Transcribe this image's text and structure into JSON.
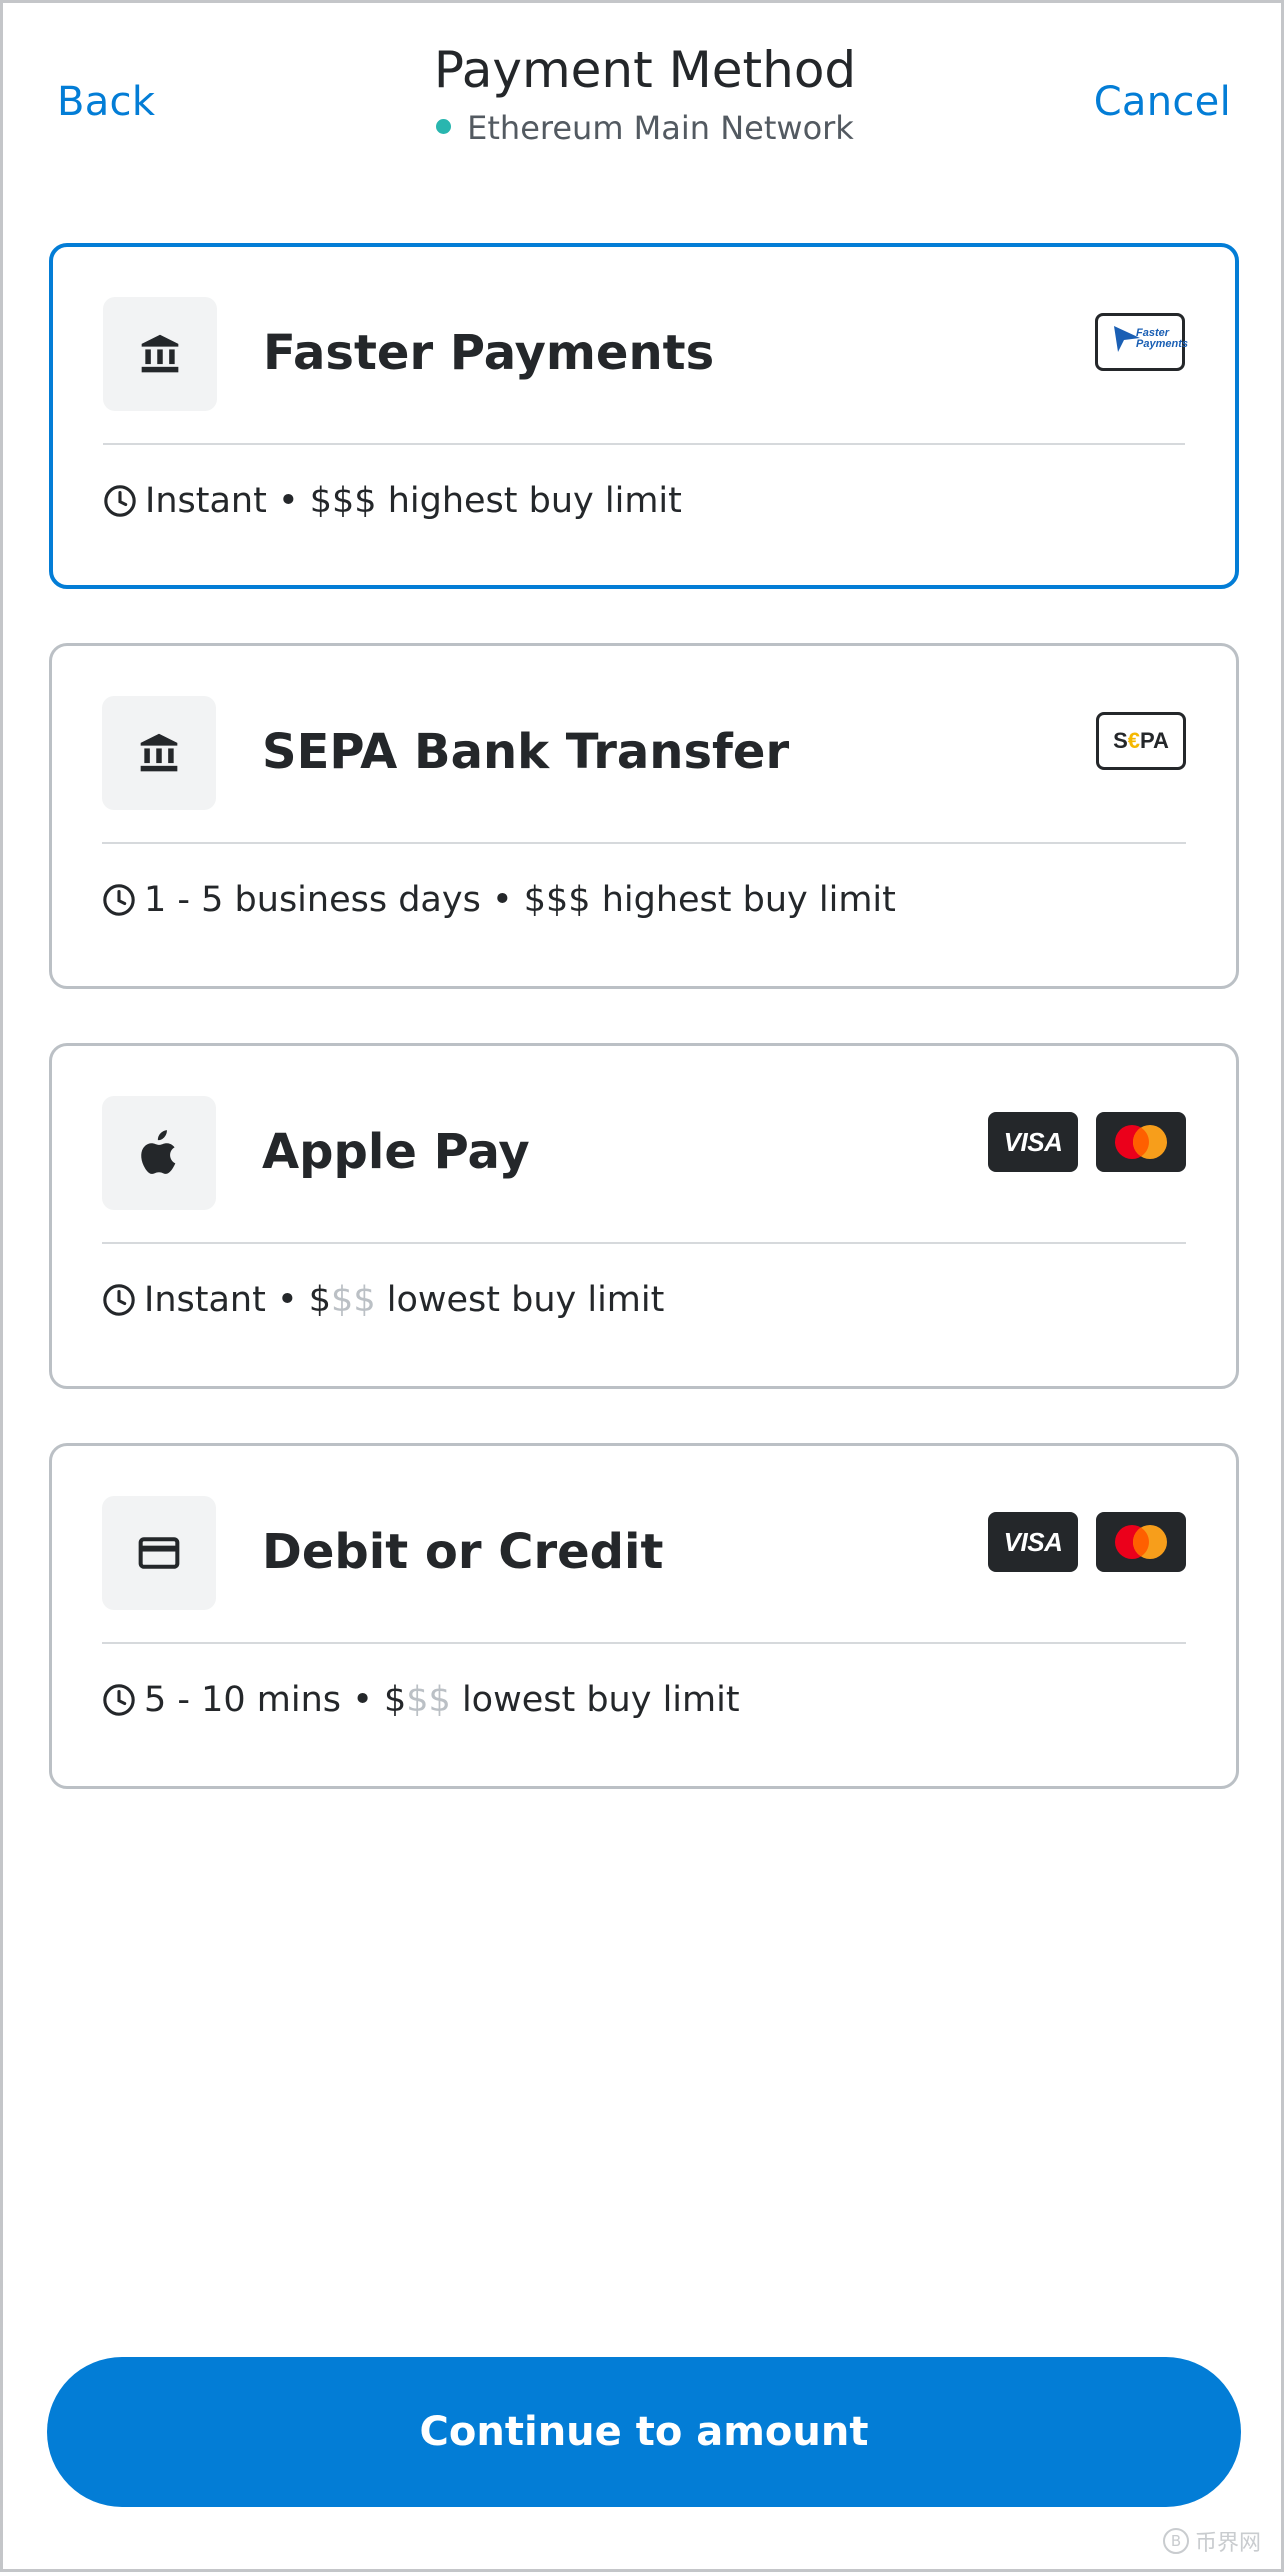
{
  "header": {
    "back_label": "Back",
    "title": "Payment Method",
    "network_label": "Ethereum Main Network",
    "network_status_color": "#29b6af",
    "cancel_label": "Cancel"
  },
  "payment_methods": [
    {
      "title": "Faster Payments",
      "icon": "bank-icon",
      "selected": true,
      "badges": [
        "faster-payments-logo"
      ],
      "badge_text": "Faster Payments",
      "speed": "Instant",
      "separator": "•",
      "limit_strong": "$$$",
      "limit_muted": "",
      "limit_text": "highest buy limit"
    },
    {
      "title": "SEPA Bank Transfer",
      "icon": "bank-icon",
      "selected": false,
      "badges": [
        "sepa-logo"
      ],
      "badge_text_1": "S",
      "badge_text_2": "€",
      "badge_text_3": "PA",
      "speed": "1 - 5 business days",
      "separator": "•",
      "limit_strong": "$$$",
      "limit_muted": "",
      "limit_text": "highest buy limit"
    },
    {
      "title": "Apple Pay",
      "icon": "apple-icon",
      "selected": false,
      "badges": [
        "visa-logo",
        "mastercard-logo"
      ],
      "visa_text": "VISA",
      "speed": "Instant",
      "separator": "•",
      "limit_strong": "$",
      "limit_muted": "$$",
      "limit_text": "lowest buy limit"
    },
    {
      "title": "Debit or Credit",
      "icon": "credit-card-icon",
      "selected": false,
      "badges": [
        "visa-logo",
        "mastercard-logo"
      ],
      "visa_text": "VISA",
      "speed": "5 - 10 mins",
      "separator": "•",
      "limit_strong": "$",
      "limit_muted": "$$",
      "limit_text": "lowest buy limit"
    }
  ],
  "footer": {
    "continue_label": "Continue to amount"
  },
  "colors": {
    "accent": "#037dd6",
    "text": "#24272a",
    "muted": "#bbc0c5",
    "mastercard_red": "#eb001b",
    "mastercard_orange": "#f79e1b",
    "sepa_yellow": "#f5b800"
  },
  "watermark": {
    "text": "币界网",
    "circle_symbol": "B"
  }
}
